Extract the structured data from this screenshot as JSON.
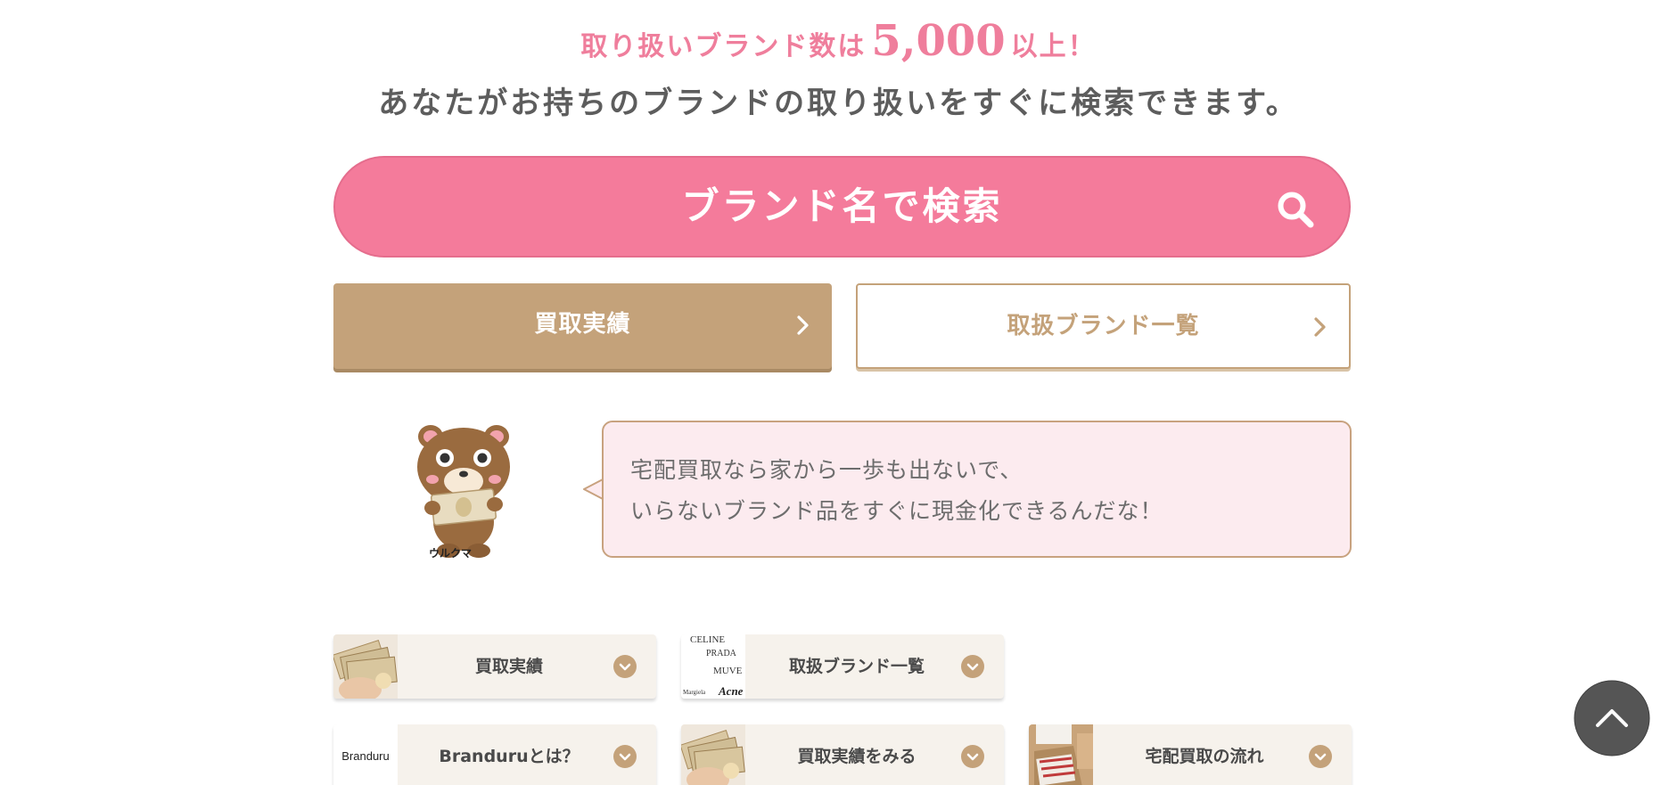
{
  "headline": {
    "prefix": "取り扱いブランド数は",
    "count": "5,000",
    "suffix": "以上！"
  },
  "subheadline": "あなたがお持ちのブランドの取り扱いをすぐに検索できます。",
  "search_button": {
    "label": "ブランド名で検索",
    "icon": "search-icon"
  },
  "nav_buttons": [
    {
      "label": "買取実績",
      "icon": "chevron-right-icon"
    },
    {
      "label": "取扱ブランド一覧",
      "icon": "chevron-right-icon"
    }
  ],
  "mascot": {
    "name": "ウルクマ"
  },
  "speech_bubble": {
    "lines": [
      "宅配買取なら家から一歩も出ないで、",
      "いらないブランド品をすぐに現金化できるんだな！"
    ]
  },
  "cards": [
    {
      "label": "買取実績",
      "thumb": "cash-photo"
    },
    {
      "label": "取扱ブランド一覧",
      "thumb": "brand-logos-photo",
      "thumb_text": [
        "CELINE",
        "PRADA",
        "MUVE",
        "Margiela",
        "Acne"
      ]
    },
    {
      "label": "Branduruとは？",
      "thumb": "branduru-logo",
      "thumb_text": [
        "Branduru"
      ]
    },
    {
      "label": "買取実績をみる",
      "thumb": "cash-photo"
    },
    {
      "label": "宅配買取の流れ",
      "thumb": "delivery-photo"
    }
  ],
  "page_top_button": {
    "icon": "chevron-up-icon"
  },
  "colors": {
    "pink": "#f47b9b",
    "gold": "#c4a27a",
    "bubble_bg": "#fcebef",
    "card_bg": "#f6f2ec",
    "page_top_bg": "#555555"
  }
}
